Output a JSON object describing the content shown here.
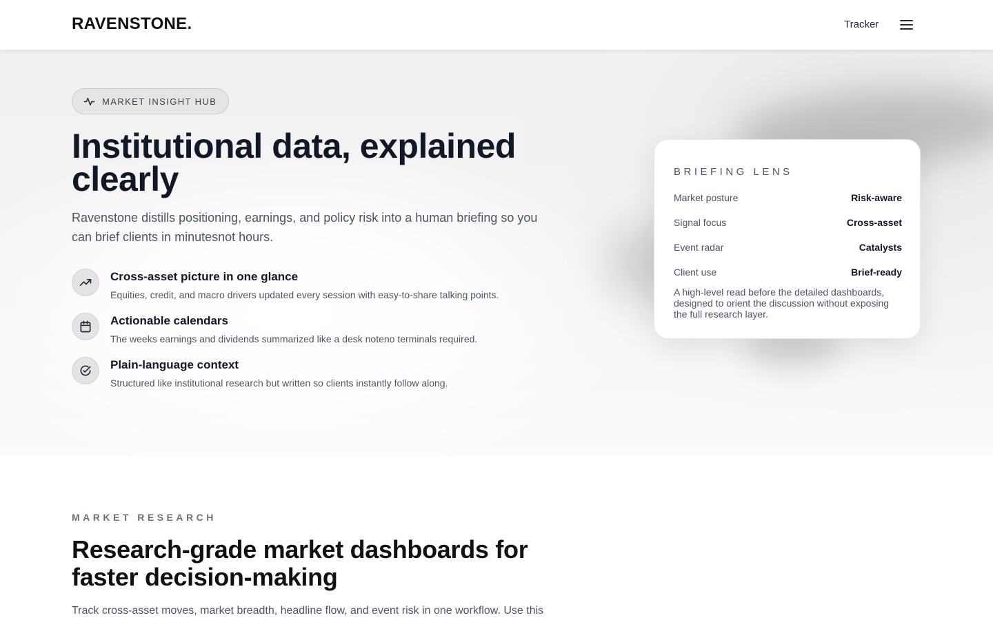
{
  "header": {
    "logo": "RAVENSTONE.",
    "nav_tracker": "Tracker",
    "menu_icon": "hamburger-menu-icon"
  },
  "hero": {
    "badge": {
      "icon": "activity-pulse-icon",
      "label": "MARKET INSIGHT HUB"
    },
    "title": "Institutional data, explained clearly",
    "subtitle": "Ravenstone distills positioning, earnings, and policy risk into a human briefing so you can brief clients in minutesnot hours.",
    "features": [
      {
        "icon": "trending-up-icon",
        "title": "Cross-asset picture in one glance",
        "description": "Equities, credit, and macro drivers updated every session with easy-to-share talking points."
      },
      {
        "icon": "calendar-icon",
        "title": "Actionable calendars",
        "description": "The weeks earnings and dividends summarized like a desk noteno terminals required."
      },
      {
        "icon": "check-circle-icon",
        "title": "Plain-language context",
        "description": "Structured like institutional research but written so clients instantly follow along."
      }
    ]
  },
  "briefing_card": {
    "heading": "BRIEFING LENS",
    "rows": [
      {
        "label": "Market posture",
        "value": "Risk-aware"
      },
      {
        "label": "Signal focus",
        "value": "Cross-asset"
      },
      {
        "label": "Event radar",
        "value": "Catalysts"
      },
      {
        "label": "Client use",
        "value": "Brief-ready"
      }
    ],
    "note": "A high-level read before the detailed dashboards, designed to orient the discussion without exposing the full research layer."
  },
  "market_research": {
    "eyebrow": "MARKET RESEARCH",
    "title": "Research-grade market dashboards for faster decision-making",
    "description": "Track cross-asset moves, market breadth, headline flow, and event risk in one workflow. Use this"
  }
}
